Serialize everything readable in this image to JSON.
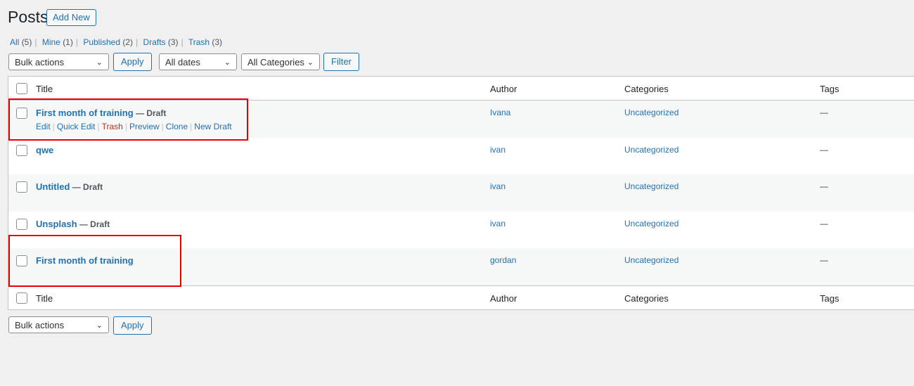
{
  "page": {
    "title": "Posts",
    "add_new": "Add New"
  },
  "filters_links": [
    {
      "label": "All",
      "count": "(5)"
    },
    {
      "label": "Mine",
      "count": "(1)"
    },
    {
      "label": "Published",
      "count": "(2)"
    },
    {
      "label": "Drafts",
      "count": "(3)"
    },
    {
      "label": "Trash",
      "count": "(3)"
    }
  ],
  "toolbar": {
    "bulk": "Bulk actions",
    "apply": "Apply",
    "dates": "All dates",
    "categories": "All Categories",
    "filter": "Filter"
  },
  "columns": {
    "title": "Title",
    "author": "Author",
    "categories": "Categories",
    "tags": "Tags"
  },
  "rows": [
    {
      "title": "First month of training",
      "state": " — Draft",
      "author": "Ivana",
      "category": "Uncategorized",
      "tags": "—"
    },
    {
      "title": "qwe",
      "state": "",
      "author": "ivan",
      "category": "Uncategorized",
      "tags": "—"
    },
    {
      "title": "Untitled",
      "state": " — Draft",
      "author": "ivan",
      "category": "Uncategorized",
      "tags": "—"
    },
    {
      "title": "Unsplash",
      "state": " — Draft",
      "author": "ivan",
      "category": "Uncategorized",
      "tags": "—"
    },
    {
      "title": "First month of training",
      "state": "",
      "author": "gordan",
      "category": "Uncategorized",
      "tags": "—"
    }
  ],
  "row_actions": {
    "edit": "Edit",
    "quick_edit": "Quick Edit",
    "trash": "Trash",
    "preview": "Preview",
    "clone": "Clone",
    "new_draft": "New Draft"
  },
  "colors": {
    "link": "#2271b1",
    "highlight": "#e60000",
    "trash": "#b32d2e"
  }
}
